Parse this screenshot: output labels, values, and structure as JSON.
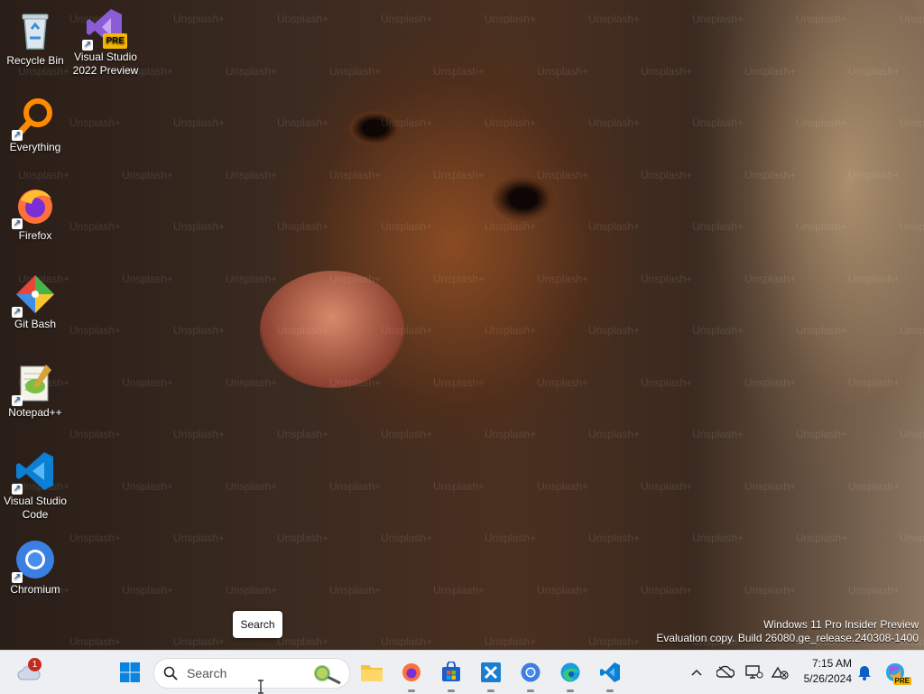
{
  "desktop": {
    "icons": [
      {
        "label": "Recycle Bin",
        "icon": "recycle-bin-icon",
        "shortcut": false
      },
      {
        "label": "Visual Studio 2022 Preview",
        "icon": "visual-studio-icon",
        "shortcut": true,
        "badge": "PRE"
      },
      {
        "label": "Everything",
        "icon": "everything-icon",
        "shortcut": true
      },
      {
        "label": "Firefox",
        "icon": "firefox-icon",
        "shortcut": true
      },
      {
        "label": "Git Bash",
        "icon": "git-bash-icon",
        "shortcut": true
      },
      {
        "label": "Notepad++",
        "icon": "notepad-plus-plus-icon",
        "shortcut": true
      },
      {
        "label": "Visual Studio Code",
        "icon": "vscode-icon",
        "shortcut": true
      },
      {
        "label": "Chromium",
        "icon": "chromium-icon",
        "shortcut": true
      }
    ],
    "wallpaper_watermark": "Unsplash+",
    "tooltip": "Search",
    "os_watermark": {
      "line1": "Windows 11 Pro Insider Preview",
      "line2": "Evaluation copy. Build 26080.ge_release.240308-1400"
    }
  },
  "taskbar": {
    "weather_badge": "1",
    "search_placeholder": "Search",
    "apps": [
      "file-explorer-icon",
      "firefox-icon",
      "microsoft-store-icon",
      "xbox-icon",
      "chromium-icon",
      "edge-icon",
      "vscode-icon"
    ],
    "tray": [
      "chevron-up-icon",
      "onedrive-offline-icon",
      "display-icon",
      "network-icon",
      "notification-bell-icon",
      "copilot-icon"
    ],
    "time": "7:15 AM",
    "date": "5/26/2024",
    "copilot_badge": "PRE"
  },
  "colors": {
    "accent": "#0067c0",
    "taskbar_bg": "#eeeff3"
  }
}
